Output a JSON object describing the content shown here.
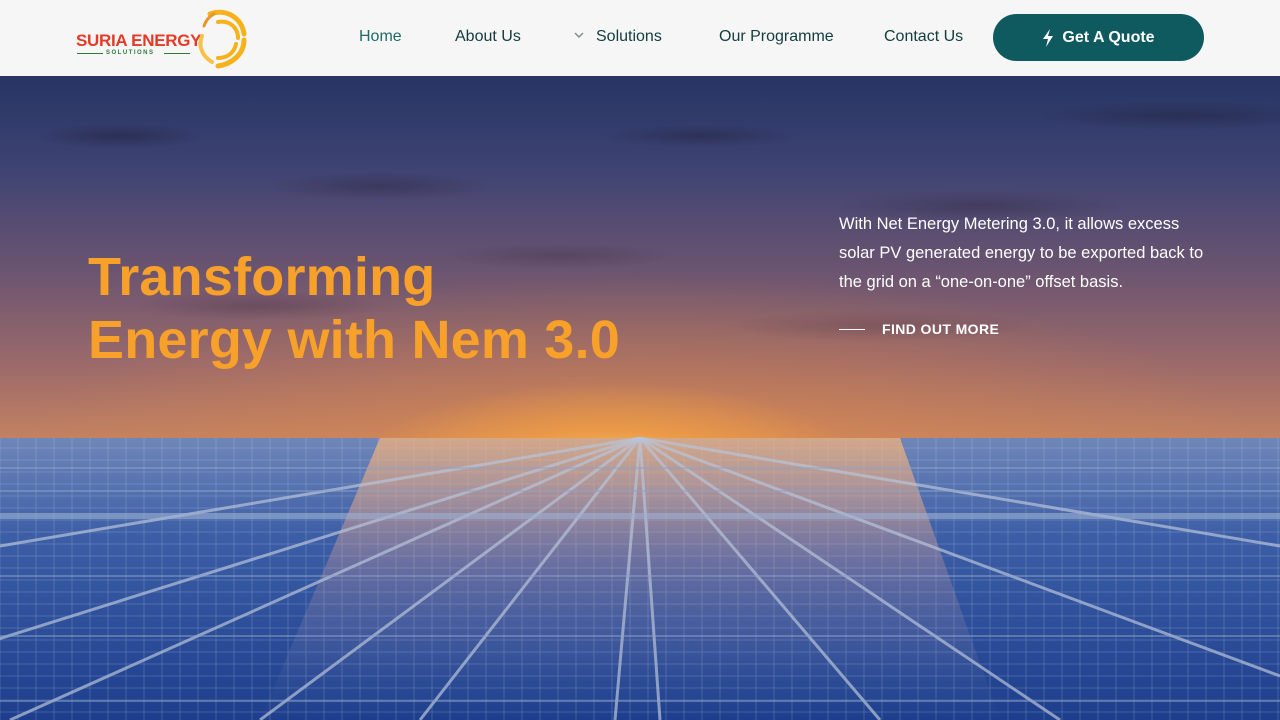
{
  "brand": {
    "name": "SURIA ENERGY",
    "tagline": "SOLUTIONS",
    "text_color": "#e53a25",
    "tagline_color": "#2d7a3a",
    "sun_color": "#f5b21c"
  },
  "nav": {
    "items": [
      {
        "label": "Home",
        "active": true
      },
      {
        "label": "About Us",
        "active": false
      },
      {
        "label": "Solutions",
        "active": false,
        "has_dropdown": true
      },
      {
        "label": "Our Programme",
        "active": false
      },
      {
        "label": "Contact Us",
        "active": false
      }
    ],
    "cta": {
      "label": "Get A Quote",
      "icon": "bolt-icon",
      "color": "#0f5a5f"
    }
  },
  "hero": {
    "title_line1": "Transforming",
    "title_line2": "Energy with Nem 3.0",
    "title_color": "#f7a02a",
    "description": "With Net Energy Metering 3.0, it allows excess solar PV generated energy to be exported back to the grid on a “one-on-one” offset basis.",
    "link_label": "FIND OUT MORE",
    "background": "sunset-solar-panels-photo"
  }
}
